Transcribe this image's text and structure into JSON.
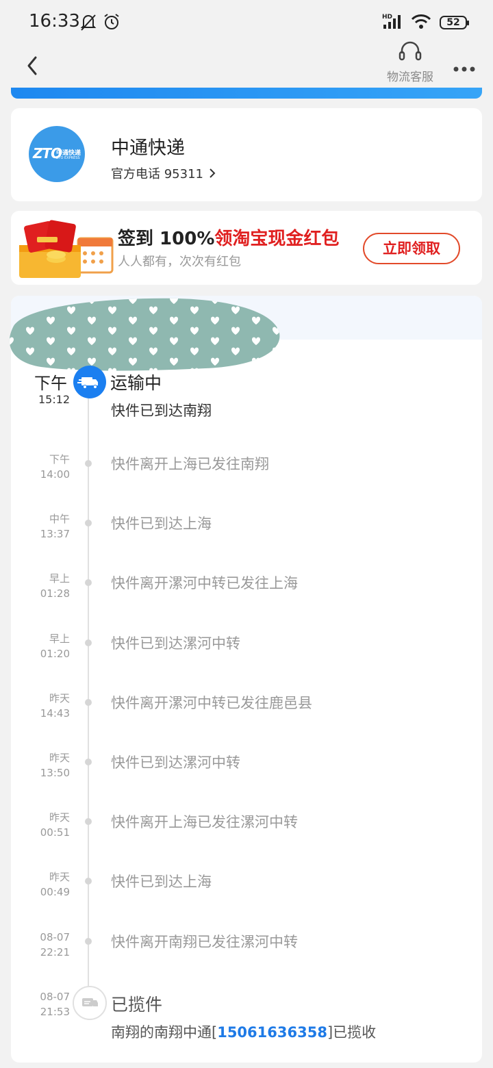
{
  "status_bar": {
    "time": "16:33",
    "battery": "52",
    "network": "HD"
  },
  "nav": {
    "service_label": "物流客服"
  },
  "company": {
    "logo_text": "ZTO",
    "logo_cn": "中通快递",
    "logo_en": "ZTO EXPRESS",
    "name": "中通快递",
    "phone_label": "官方电话 95311"
  },
  "promo": {
    "title_prefix": "签到 100%",
    "title_highlight": "领淘宝现金红包",
    "subtitle": "人人都有，次次有红包",
    "button": "立即领取"
  },
  "current": {
    "time_period": "下午",
    "time": "15:12",
    "status": "运输中",
    "description": "快件已到达南翔"
  },
  "events": [
    {
      "period": "下午",
      "time": "14:00",
      "text": "快件离开上海已发往南翔"
    },
    {
      "period": "中午",
      "time": "13:37",
      "text": "快件已到达上海"
    },
    {
      "period": "早上",
      "time": "01:28",
      "text": "快件离开漯河中转已发往上海"
    },
    {
      "period": "早上",
      "time": "01:20",
      "text": "快件已到达漯河中转"
    },
    {
      "period": "昨天",
      "time": "14:43",
      "text": "快件离开漯河中转已发往鹿邑县"
    },
    {
      "period": "昨天",
      "time": "13:50",
      "text": "快件已到达漯河中转"
    },
    {
      "period": "昨天",
      "time": "00:51",
      "text": "快件离开上海已发往漯河中转"
    },
    {
      "period": "昨天",
      "time": "00:49",
      "text": "快件已到达上海"
    },
    {
      "period": "08-07",
      "time": "22:21",
      "text": "快件离开南翔已发往漯河中转"
    }
  ],
  "pickup": {
    "period": "08-07",
    "time": "21:53",
    "status": "已揽件",
    "desc_prefix": "南翔的南翔中通[",
    "phone": "15061636358",
    "desc_suffix": "]已揽收"
  },
  "colors": {
    "accent": "#1b7ff0",
    "promo_red": "#e02020",
    "redaction": "#8fb8b0"
  }
}
